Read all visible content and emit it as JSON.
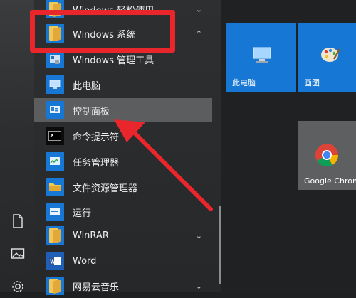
{
  "start_menu": {
    "items": [
      {
        "label": "Windows 轻松使用",
        "chevron": "⌄"
      },
      {
        "label": "Windows 系统",
        "chevron": "⌃"
      },
      {
        "label": "Windows 管理工具"
      },
      {
        "label": "此电脑"
      },
      {
        "label": "控制面板"
      },
      {
        "label": "命令提示符"
      },
      {
        "label": "任务管理器"
      },
      {
        "label": "文件资源管理器"
      },
      {
        "label": "运行"
      },
      {
        "label": "WinRAR",
        "chevron": "⌄"
      },
      {
        "label": "Word"
      },
      {
        "label": "网易云音乐",
        "chevron": "⌄"
      }
    ]
  },
  "tiles": [
    {
      "label": "此电脑",
      "icon": "computer-icon"
    },
    {
      "label": "画图",
      "icon": "paint-palette-icon"
    },
    {
      "label": "Google Chrome",
      "icon": "chrome-icon"
    }
  ],
  "colors": {
    "accent_blue": "#1777d4",
    "highlight_red": "#e8262c",
    "selected_bg": "#5b5d5f"
  }
}
